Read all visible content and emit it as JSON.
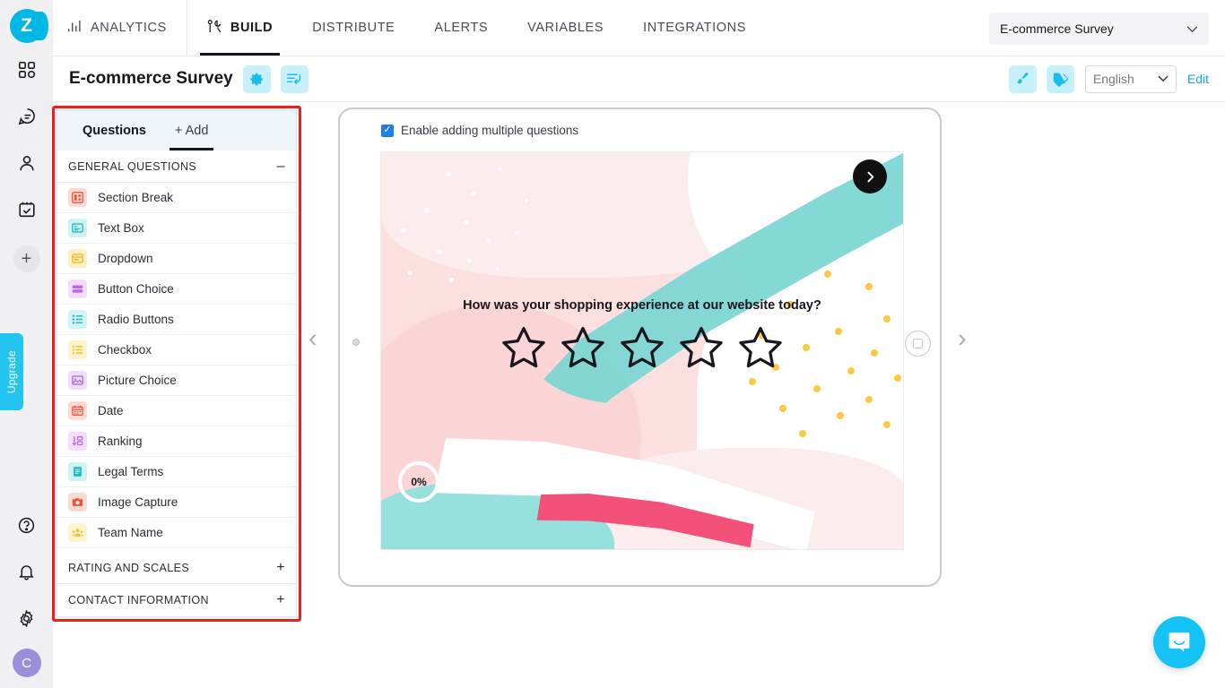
{
  "brand": {
    "logo_letter": "Z",
    "accent": "#00b8e6",
    "outline_red": "#f41b1b"
  },
  "rail": {
    "items": [
      {
        "name": "dashboard-icon",
        "label": "Dashboard"
      },
      {
        "name": "surveys-icon",
        "label": "Surveys"
      },
      {
        "name": "contacts-icon",
        "label": "Contacts"
      },
      {
        "name": "tasks-icon",
        "label": "Tasks"
      }
    ],
    "add_label": "+",
    "upgrade_label": "Upgrade",
    "bottom_items": [
      {
        "name": "help-icon",
        "label": "Help"
      },
      {
        "name": "notifications-icon",
        "label": "Notifications"
      },
      {
        "name": "settings-icon",
        "label": "Settings"
      }
    ],
    "avatar_letter": "C"
  },
  "topnav": {
    "tabs": [
      {
        "label": "ANALYTICS",
        "icon": "analytics-icon",
        "active": false
      },
      {
        "label": "BUILD",
        "icon": "build-icon",
        "active": true
      },
      {
        "label": "DISTRIBUTE",
        "icon": "",
        "active": false
      },
      {
        "label": "ALERTS",
        "icon": "",
        "active": false
      },
      {
        "label": "VARIABLES",
        "icon": "",
        "active": false
      },
      {
        "label": "INTEGRATIONS",
        "icon": "",
        "active": false
      }
    ],
    "survey_selector": {
      "value": "E-commerce Survey",
      "chevron": "⌄"
    }
  },
  "subheader": {
    "title": "E-commerce Survey",
    "settings_button": "gear-icon",
    "revert_button": "revert-icon",
    "theme_button": "paintbrush-icon",
    "tag_button": "tag-icon",
    "language": {
      "value": "English",
      "chevron": "⌄"
    },
    "edit_label": "Edit"
  },
  "questions_panel": {
    "tabs": [
      {
        "label": "Questions",
        "active": false
      },
      {
        "label": "+ Add",
        "active": true
      }
    ],
    "groups": [
      {
        "label": "GENERAL QUESTIONS",
        "sign": "–",
        "expanded": true
      },
      {
        "label": "RATING AND SCALES",
        "sign": "+",
        "expanded": false
      },
      {
        "label": "CONTACT INFORMATION",
        "sign": "+",
        "expanded": false
      }
    ],
    "items": [
      {
        "label": "Section Break",
        "icon": "section-break-icon",
        "bg": "#fcd9d2",
        "fg": "#f4513a"
      },
      {
        "label": "Text Box",
        "icon": "text-box-icon",
        "bg": "#cdf2f2",
        "fg": "#18b4c8"
      },
      {
        "label": "Dropdown",
        "icon": "dropdown-icon",
        "bg": "#fdefc2",
        "fg": "#f0b323"
      },
      {
        "label": "Button Choice",
        "icon": "button-choice-icon",
        "bg": "#f4dcfc",
        "fg": "#c264ef"
      },
      {
        "label": "Radio Buttons",
        "icon": "radio-buttons-icon",
        "bg": "#d2f2f5",
        "fg": "#25bcd0"
      },
      {
        "label": "Checkbox",
        "icon": "checkbox-icon",
        "bg": "#fdf3cc",
        "fg": "#f2c230"
      },
      {
        "label": "Picture Choice",
        "icon": "picture-choice-icon",
        "bg": "#f0dcfb",
        "fg": "#a762e8"
      },
      {
        "label": "Date",
        "icon": "date-icon",
        "bg": "#fcd9d2",
        "fg": "#f4513a"
      },
      {
        "label": "Ranking",
        "icon": "ranking-icon",
        "bg": "#f4dcfc",
        "fg": "#b063e8"
      },
      {
        "label": "Legal Terms",
        "icon": "legal-terms-icon",
        "bg": "#cdf2f2",
        "fg": "#17b8c4"
      },
      {
        "label": "Image Capture",
        "icon": "image-capture-icon",
        "bg": "#fcd9d2",
        "fg": "#f4513a"
      },
      {
        "label": "Team Name",
        "icon": "team-name-icon",
        "bg": "#fdf3cc",
        "fg": "#f0c23a"
      }
    ]
  },
  "preview": {
    "enable_multiple_label": "Enable adding multiple questions",
    "enable_multiple_checked": true,
    "question_text": "How was your shopping experience at our website today?",
    "star_count": 5,
    "progress_label": "0%",
    "next_button": "next-arrow-icon",
    "prev_arrow": "‹",
    "next_arrow": "›",
    "colors": {
      "pink_bg": "#fce0e0",
      "pink_light": "#fbeced",
      "teal": "#7ad6d3",
      "teal_bottom": "#96e0dd",
      "magenta": "#f4517a",
      "yellow_dot": "#fcc940"
    }
  },
  "chat": {
    "icon": "chat-bubble-icon"
  }
}
